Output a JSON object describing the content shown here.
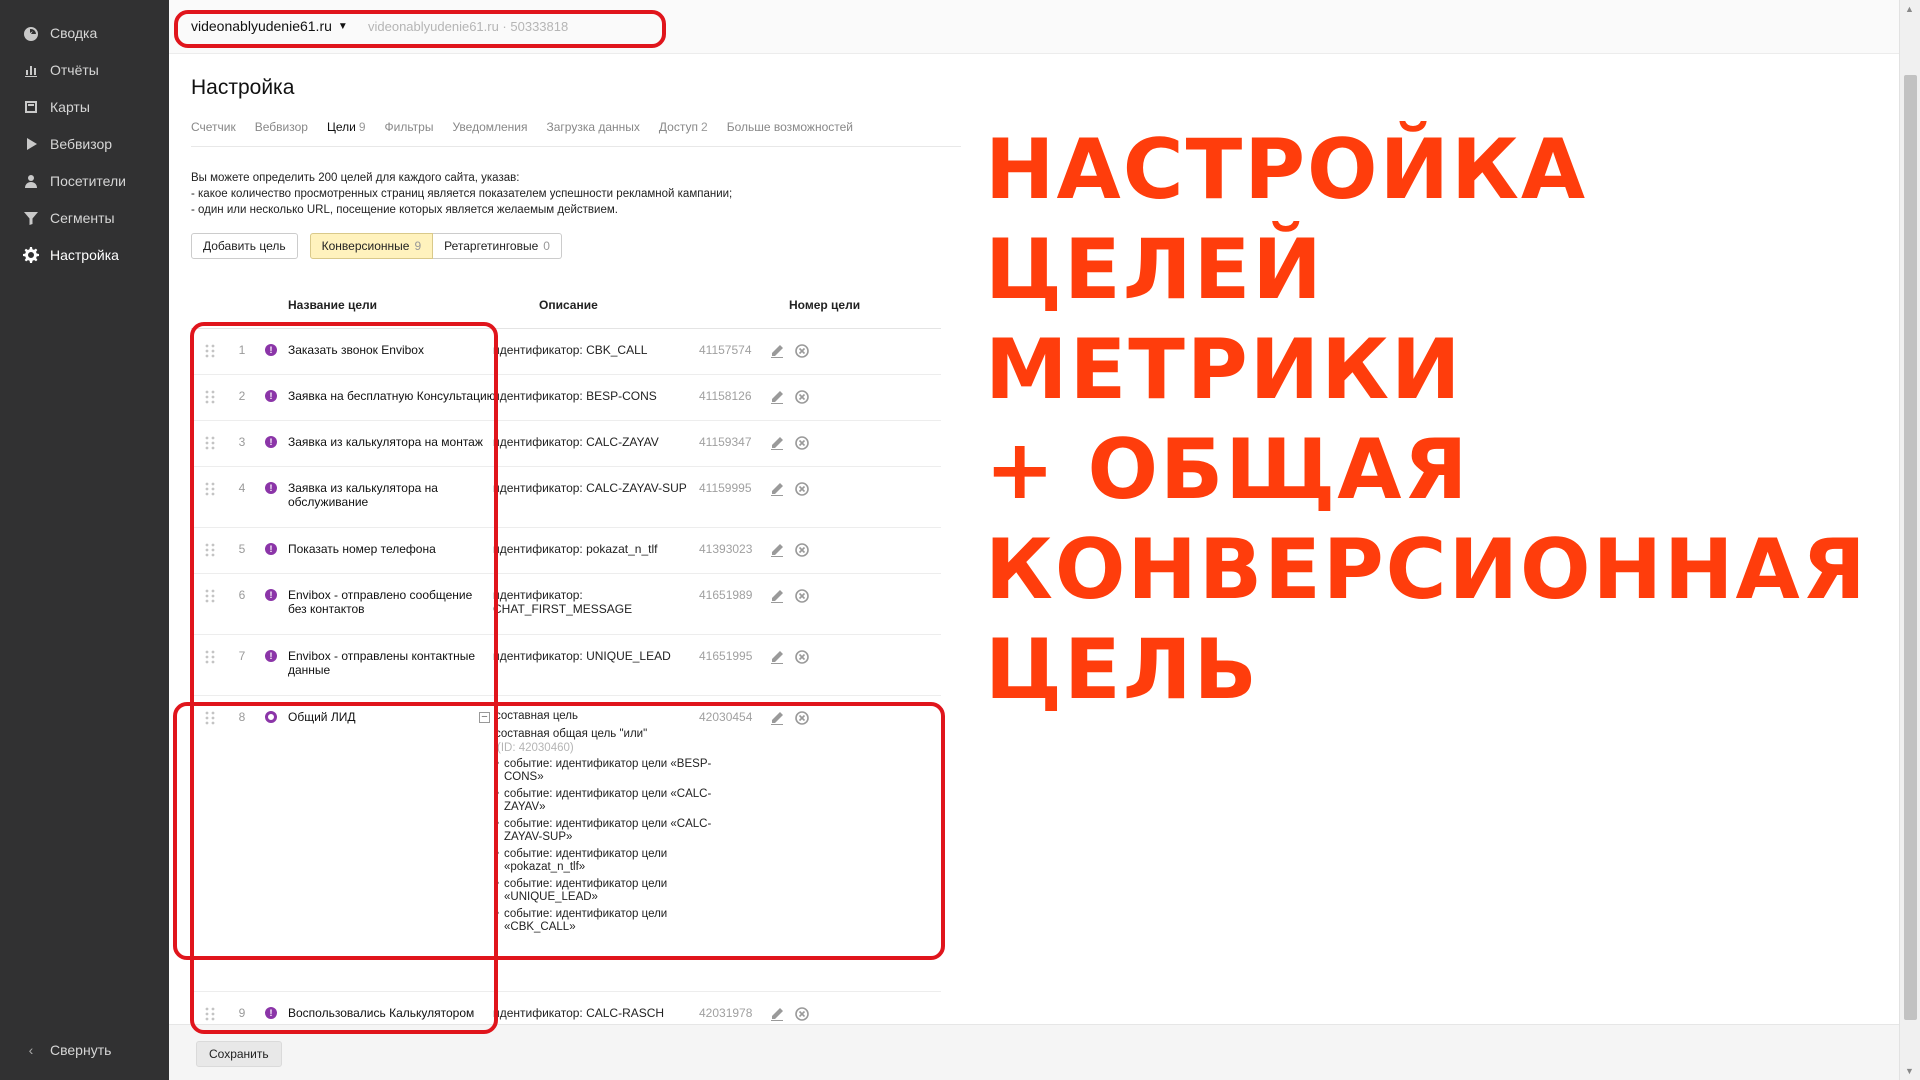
{
  "sidebar": {
    "items": [
      {
        "label": "Сводка",
        "icon": "dashboard-icon"
      },
      {
        "label": "Отчёты",
        "icon": "bar-chart-icon"
      },
      {
        "label": "Карты",
        "icon": "map-icon"
      },
      {
        "label": "Вебвизор",
        "icon": "play-icon"
      },
      {
        "label": "Посетители",
        "icon": "person-icon"
      },
      {
        "label": "Сегменты",
        "icon": "filter-icon"
      },
      {
        "label": "Настройка",
        "icon": "gear-icon"
      }
    ],
    "collapse_label": "Свернуть"
  },
  "topbar": {
    "site": "videonablyudenie61.ru",
    "site_secondary": "videonablyudenie61.ru · 50333818"
  },
  "page": {
    "title": "Настройка",
    "tabs": [
      {
        "label": "Счетчик",
        "count": ""
      },
      {
        "label": "Вебвизор",
        "count": ""
      },
      {
        "label": "Цели",
        "count": "9"
      },
      {
        "label": "Фильтры",
        "count": ""
      },
      {
        "label": "Уведомления",
        "count": ""
      },
      {
        "label": "Загрузка данных",
        "count": ""
      },
      {
        "label": "Доступ",
        "count": "2"
      },
      {
        "label": "Больше возможностей",
        "count": ""
      }
    ],
    "intro": [
      "Вы можете определить 200 целей для каждого сайта, указав:",
      "- какое количество просмотренных страниц является показателем успешности рекламной кампании;",
      "- один или несколько URL, посещение которых является желаемым действием."
    ],
    "add_goal": "Добавить цель",
    "conversion_label": "Конверсионные",
    "conversion_count": "9",
    "retarget_label": "Ретаргетинговые",
    "retarget_count": "0"
  },
  "table": {
    "headers": {
      "name": "Название цели",
      "desc": "Описание",
      "id": "Номер цели"
    },
    "rows": [
      {
        "num": "1",
        "name": "Заказать звонок Envibox",
        "desc": "идентификатор: CBK_CALL",
        "id": "41157574"
      },
      {
        "num": "2",
        "name": "Заявка на бесплатную Консультацию",
        "desc": "идентификатор: BESP-CONS",
        "id": "41158126"
      },
      {
        "num": "3",
        "name": "Заявка из калькулятора на монтаж",
        "desc": "идентификатор: CALC-ZAYAV",
        "id": "41159347"
      },
      {
        "num": "4",
        "name": "Заявка из калькулятора на обслуживание",
        "desc": "идентификатор: CALC-ZAYAV-SUP",
        "id": "41159995"
      },
      {
        "num": "5",
        "name": "Показать номер телефона",
        "desc": "идентификатор: pokazat_n_tlf",
        "id": "41393023"
      },
      {
        "num": "6",
        "name": "Envibox - отправлено сообщение без контактов",
        "desc": "идентификатор: CHAT_FIRST_MESSAGE",
        "id": "41651989"
      },
      {
        "num": "7",
        "name": "Envibox - отправлены контактные данные",
        "desc": "идентификатор: UNIQUE_LEAD",
        "id": "41651995"
      },
      {
        "num": "8",
        "name": "Общий ЛИД",
        "desc": "",
        "id": "42030454"
      },
      {
        "num": "9",
        "name": "Воспользовались Калькулятором",
        "desc": "идентификатор: CALC-RASCH",
        "id": "42031978"
      }
    ],
    "composite": {
      "title": "составная цель",
      "subtitle": "составная общая цель \"или\"",
      "sub_id": "(ID: 42030460)",
      "events": [
        "событие: идентификатор цели «BESP-CONS»",
        "событие: идентификатор цели «CALC-ZAYAV»",
        "событие: идентификатор цели «CALC-ZAYAV-SUP»",
        "событие: идентификатор цели «pokazat_n_tlf»",
        "событие: идентификатор цели «UNIQUE_LEAD»",
        "событие: идентификатор цели «CBK_CALL»"
      ]
    }
  },
  "footer": {
    "save": "Сохранить"
  },
  "annotation": {
    "lines": [
      "НАСТРОЙКА",
      "ЦЕЛЕЙ",
      "МЕТРИКИ",
      "+ ОБЩАЯ",
      "КОНВЕРСИОННАЯ",
      "ЦЕЛЬ"
    ],
    "color": "#ff3d0c",
    "box_color": "#e0151c"
  },
  "colors": {
    "sidebar_bg": "#313132",
    "goal_icon": "#8b35a8",
    "conversion_active": "#fff2bd"
  }
}
